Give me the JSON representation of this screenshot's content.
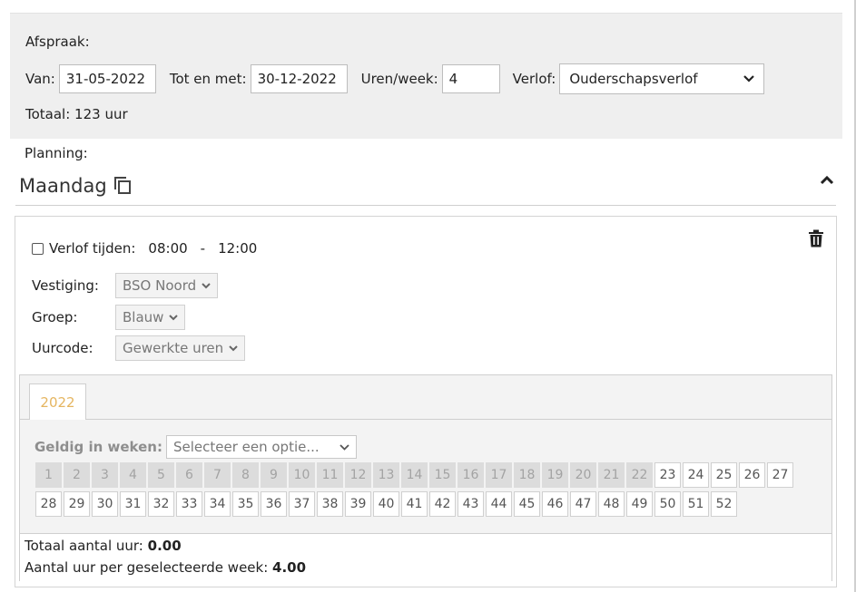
{
  "afspraak": {
    "title": "Afspraak:",
    "van_label": "Van:",
    "van_value": "31-05-2022",
    "tot_label": "Tot en met:",
    "tot_value": "30-12-2022",
    "uren_label": "Uren/week:",
    "uren_value": "4",
    "verlof_label": "Verlof:",
    "verlof_value": "Ouderschapsverlof",
    "totaal": "Totaal: 123 uur"
  },
  "planning": {
    "label": "Planning:",
    "day": "Maandag"
  },
  "entry": {
    "verlof_tijden_label": "Verlof tijden:",
    "verlof_checked": false,
    "time_from": "08:00",
    "time_sep": "-",
    "time_to": "12:00",
    "vestiging_label": "Vestiging:",
    "vestiging_value": "BSO Noord",
    "groep_label": "Groep:",
    "groep_value": "Blauw",
    "uurcode_label": "Uurcode:",
    "uurcode_value": "Gewerkte uren"
  },
  "year_panel": {
    "tab": "2022",
    "geldig_label": "Geldig in weken:",
    "weeks_placeholder": "Selecteer een optie...",
    "past_weeks_until": 22,
    "weeks_row1": [
      "1",
      "2",
      "3",
      "4",
      "5",
      "6",
      "7",
      "8",
      "9",
      "10",
      "11",
      "12",
      "13",
      "14",
      "15",
      "16",
      "17",
      "18",
      "19",
      "20",
      "21",
      "22",
      "23",
      "24",
      "25",
      "26",
      "27"
    ],
    "weeks_row2": [
      "28",
      "29",
      "30",
      "31",
      "32",
      "33",
      "34",
      "35",
      "36",
      "37",
      "38",
      "39",
      "40",
      "41",
      "42",
      "43",
      "44",
      "45",
      "46",
      "47",
      "48",
      "49",
      "50",
      "51",
      "52"
    ],
    "totaal_label": "Totaal aantal uur:",
    "totaal_value": "0.00",
    "per_week_label": "Aantal uur per geselecteerde week:",
    "per_week_value": "4.00"
  },
  "colors": {
    "panel_bg": "#efefef",
    "tab_year": "#e5b560",
    "past_week_bg": "#dcdcdc"
  }
}
